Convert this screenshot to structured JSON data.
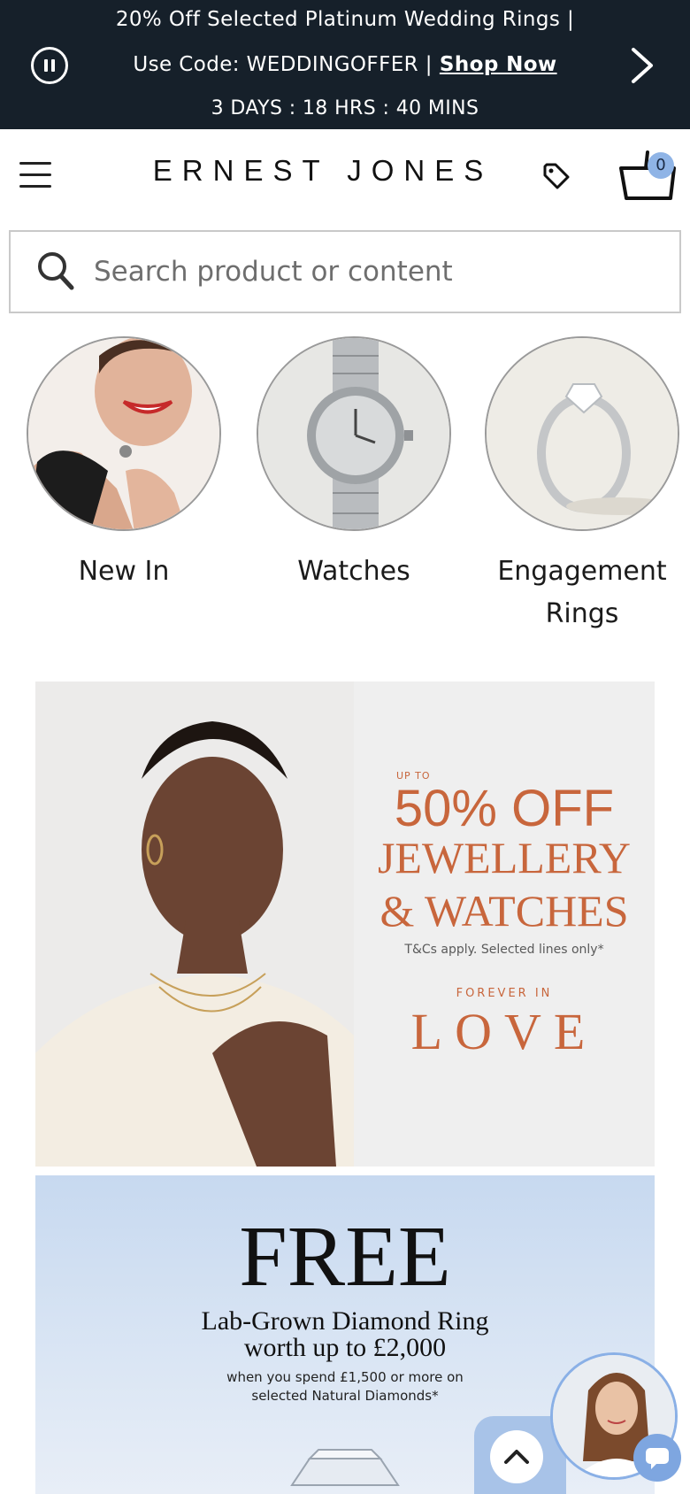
{
  "promo": {
    "line1": "20% Off Selected Platinum Wedding Rings |",
    "line2": "Use Code: WEDDINGOFFER |",
    "shop_now": "Shop Now",
    "countdown": "3 DAYS : 18 HRS : 40 MINS"
  },
  "header": {
    "logo": "ERNEST JONES",
    "basket_count": "0"
  },
  "search": {
    "placeholder": "Search product or content"
  },
  "categories": [
    {
      "label": "New In"
    },
    {
      "label": "Watches"
    },
    {
      "label": "Engagement Rings"
    }
  ],
  "banner_sale": {
    "up_to": "UP TO",
    "headline": "50% OFF",
    "line2": "JEWELLERY",
    "line3": "& WATCHES",
    "terms": "T&Cs apply. Selected lines only*",
    "tagline_small": "FOREVER IN",
    "tagline_big": "LOVE"
  },
  "banner_free": {
    "headline": "FREE",
    "line1": "Lab-Grown Diamond Ring",
    "line2": "worth up to £2,000",
    "detail1": "when you spend £1,500 or more on",
    "detail2": "selected Natural Diamonds*"
  },
  "colors": {
    "promo_bg": "#16202a",
    "sale_accent": "#c8663c",
    "badge": "#8fb4e6",
    "chat_accent": "#7ea6e0"
  }
}
